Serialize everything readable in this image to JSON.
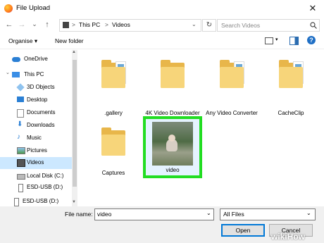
{
  "window": {
    "title": "File Upload",
    "close_label": "✕"
  },
  "nav": {
    "back": "←",
    "forward": "→",
    "dropdown": "⌄",
    "up": "↑",
    "breadcrumb": [
      "This PC",
      "Videos"
    ],
    "separator": ">",
    "refresh": "↻",
    "search_placeholder": "Search Videos"
  },
  "toolbar": {
    "organise": "Organise ▾",
    "new_folder": "New folder"
  },
  "sidebar": {
    "items": [
      {
        "label": "OneDrive",
        "icon": "cloud-icon"
      },
      {
        "label": "This PC",
        "icon": "computer-icon"
      },
      {
        "label": "3D Objects",
        "icon": "cube-icon"
      },
      {
        "label": "Desktop",
        "icon": "desktop-icon"
      },
      {
        "label": "Documents",
        "icon": "document-icon"
      },
      {
        "label": "Downloads",
        "icon": "download-icon"
      },
      {
        "label": "Music",
        "icon": "music-icon"
      },
      {
        "label": "Pictures",
        "icon": "pictures-icon"
      },
      {
        "label": "Videos",
        "icon": "video-icon"
      },
      {
        "label": "Local Disk (C:)",
        "icon": "drive-icon"
      },
      {
        "label": "ESD-USB (D:)",
        "icon": "usb-icon"
      },
      {
        "label": "ESD-USB (D:)",
        "icon": "usb-icon"
      }
    ]
  },
  "files": [
    {
      "name": ".gallery",
      "type": "folder"
    },
    {
      "name": "4K Video Downloader",
      "type": "folder"
    },
    {
      "name": "Any Video Converter",
      "type": "folder"
    },
    {
      "name": "CacheClip",
      "type": "folder"
    },
    {
      "name": "Captures",
      "type": "folder"
    },
    {
      "name": "video",
      "type": "video",
      "selected": true
    }
  ],
  "footer": {
    "file_name_label": "File name:",
    "file_name_value": "video",
    "filter_value": "All Files",
    "open_label": "Open",
    "cancel_label": "Cancel"
  },
  "watermark": {
    "text": "wikiHow"
  },
  "colors": {
    "selection_highlight": "#22dd22",
    "folder": "#f7d57a",
    "accent": "#0078d7"
  }
}
